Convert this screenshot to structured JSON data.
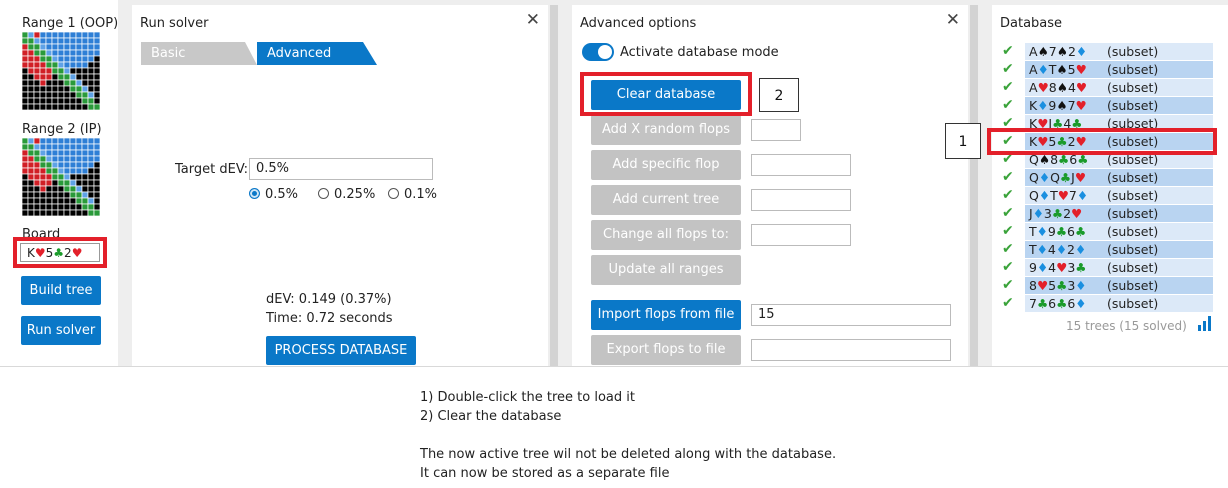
{
  "left_panel": {
    "range1_label": "Range 1 (OOP)",
    "range2_label": "Range 2 (IP)",
    "board_label": "Board",
    "board": [
      {
        "rank": "K",
        "suit": "heart"
      },
      {
        "rank": "5",
        "suit": "club"
      },
      {
        "rank": "2",
        "suit": "heart"
      }
    ],
    "build_tree": "Build tree",
    "run_solver": "Run solver"
  },
  "run_solver": {
    "title": "Run solver",
    "close": "✕",
    "tab_basic": "Basic",
    "tab_advanced": "Advanced",
    "target_label": "Target dEV:",
    "target_value": "0.5%",
    "radio_options": [
      "0.5%",
      "0.25%",
      "0.1%"
    ],
    "radio_selected": "0.5%",
    "dev_text": "dEV: 0.149 (0.37%)",
    "time_text": "Time: 0.72 seconds",
    "process_button": "PROCESS DATABASE"
  },
  "advanced": {
    "title": "Advanced options",
    "close": "✕",
    "toggle_label": "Activate database mode",
    "toggle_on": true,
    "clear_button": "Clear database",
    "add_random": "Add X random flops",
    "add_specific": "Add specific flop",
    "add_current": "Add current tree",
    "change_all": "Change all flops to:",
    "update_ranges": "Update all ranges",
    "import_button": "Import flops from file",
    "import_value": "15",
    "export_button": "Export flops to file"
  },
  "database": {
    "title": "Database",
    "close": "✕",
    "subset_label": "(subset)",
    "rows": [
      [
        {
          "r": "A",
          "s": "spade"
        },
        {
          "r": "7",
          "s": "spade"
        },
        {
          "r": "2",
          "s": "diamond"
        }
      ],
      [
        {
          "r": "A",
          "s": "diamond"
        },
        {
          "r": "T",
          "s": "spade"
        },
        {
          "r": "5",
          "s": "heart"
        }
      ],
      [
        {
          "r": "A",
          "s": "heart"
        },
        {
          "r": "8",
          "s": "spade"
        },
        {
          "r": "4",
          "s": "heart"
        }
      ],
      [
        {
          "r": "K",
          "s": "diamond"
        },
        {
          "r": "9",
          "s": "spade"
        },
        {
          "r": "7",
          "s": "heart"
        }
      ],
      [
        {
          "r": "K",
          "s": "heart"
        },
        {
          "r": "J",
          "s": "club"
        },
        {
          "r": "4",
          "s": "club"
        }
      ],
      [
        {
          "r": "K",
          "s": "heart"
        },
        {
          "r": "5",
          "s": "club"
        },
        {
          "r": "2",
          "s": "heart"
        }
      ],
      [
        {
          "r": "Q",
          "s": "spade"
        },
        {
          "r": "8",
          "s": "club"
        },
        {
          "r": "6",
          "s": "club"
        }
      ],
      [
        {
          "r": "Q",
          "s": "diamond"
        },
        {
          "r": "Q",
          "s": "club"
        },
        {
          "r": "J",
          "s": "heart"
        }
      ],
      [
        {
          "r": "Q",
          "s": "diamond"
        },
        {
          "r": "T",
          "s": "heart"
        },
        {
          "r": "7",
          "s": "diamond"
        }
      ],
      [
        {
          "r": "J",
          "s": "diamond"
        },
        {
          "r": "3",
          "s": "club"
        },
        {
          "r": "2",
          "s": "heart"
        }
      ],
      [
        {
          "r": "T",
          "s": "diamond"
        },
        {
          "r": "9",
          "s": "club"
        },
        {
          "r": "6",
          "s": "club"
        }
      ],
      [
        {
          "r": "T",
          "s": "diamond"
        },
        {
          "r": "4",
          "s": "diamond"
        },
        {
          "r": "2",
          "s": "diamond"
        }
      ],
      [
        {
          "r": "9",
          "s": "diamond"
        },
        {
          "r": "4",
          "s": "heart"
        },
        {
          "r": "3",
          "s": "club"
        }
      ],
      [
        {
          "r": "8",
          "s": "heart"
        },
        {
          "r": "5",
          "s": "club"
        },
        {
          "r": "3",
          "s": "diamond"
        }
      ],
      [
        {
          "r": "7",
          "s": "club"
        },
        {
          "r": "6",
          "s": "club"
        },
        {
          "r": "6",
          "s": "diamond"
        }
      ]
    ],
    "selected_row": 5,
    "footer": "15 trees (15 solved)"
  },
  "callouts": {
    "one": "1",
    "two": "2"
  },
  "notes": {
    "line1": "1) Double-click the tree to load it",
    "line2": "2) Clear the database",
    "line3": "The now active tree wil not be deleted along with the database.",
    "line4": "It can now be stored as a separate file"
  },
  "colors": {
    "accent": "#0a78c8",
    "highlight": "#e3202a",
    "heart": "#e3202a",
    "club": "#1a9b2a",
    "diamond": "#1a8fe0",
    "spade": "#111111",
    "check": "#3aa33a"
  }
}
